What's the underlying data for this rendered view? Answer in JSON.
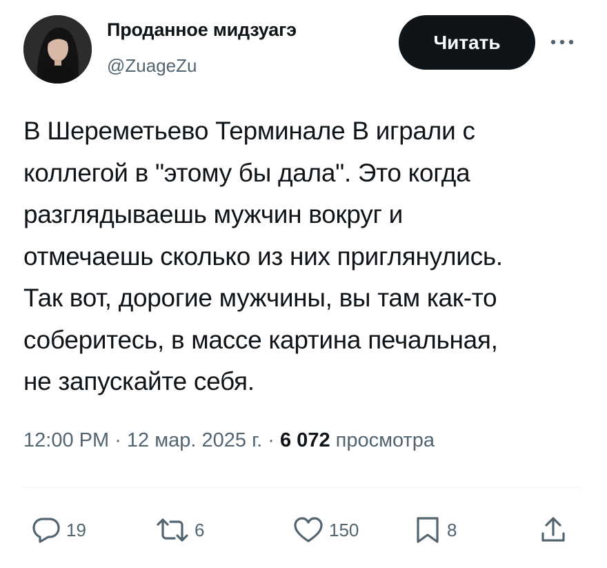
{
  "author": {
    "display_name": "Проданное мидзуагэ",
    "handle": "@ZuageZu",
    "avatar_icon": "profile-photo"
  },
  "follow_button": {
    "label": "Читать"
  },
  "more_icon": "more-horizontal-icon",
  "tweet": {
    "lines": [
      "В Шереметьево Терминале В играли с",
      "коллегой в \"этому бы дала\". Это когда",
      "разглядываешь мужчин вокруг и",
      "отмечаешь сколько из них приглянулись.",
      "Так вот, дорогие мужчины, вы там как-то",
      "соберитесь, в массе картина печальная,",
      "не запускайте себя."
    ]
  },
  "meta": {
    "time": "12:00 PM",
    "sep1": " · ",
    "date": "12 мар. 2025 г.",
    "sep2": " · ",
    "views_count": "6 072",
    "views_label": " просмотра"
  },
  "actions": {
    "reply": {
      "icon": "reply-icon",
      "count": "19"
    },
    "retweet": {
      "icon": "retweet-icon",
      "count": "6"
    },
    "like": {
      "icon": "heart-icon",
      "count": "150"
    },
    "bookmark": {
      "icon": "bookmark-icon",
      "count": "8"
    },
    "share": {
      "icon": "share-icon"
    }
  },
  "colors": {
    "text_primary": "#0f1419",
    "text_secondary": "#536471",
    "button_bg": "#0f1419",
    "divider": "#eff3f4"
  }
}
